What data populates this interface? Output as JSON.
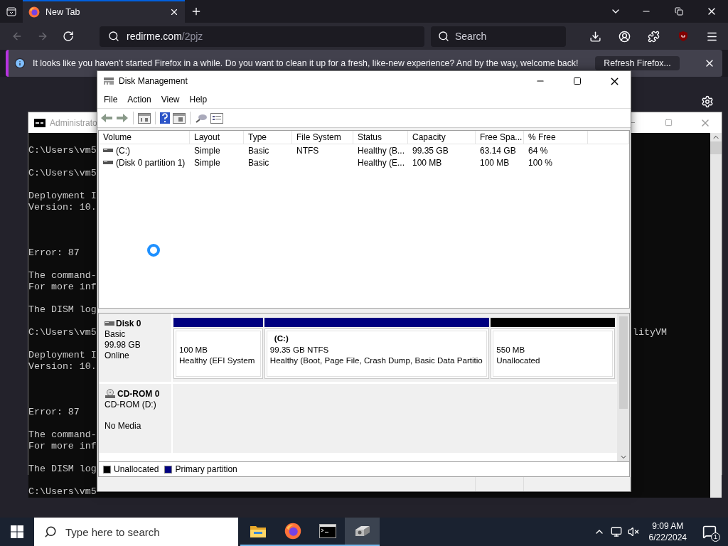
{
  "browser": {
    "tabs": [
      {
        "label": "New Tab",
        "selected": true
      }
    ],
    "nav": {
      "back_disabled": true,
      "forward_disabled": true
    },
    "url": {
      "domain": "redirme.com",
      "path": "/2pjz"
    },
    "search": {
      "placeholder": "Search"
    },
    "notification": {
      "message": "It looks like you haven’t started Firefox in a while. Do you want to clean it up for a fresh, like-new experience? And by the way, welcome back!",
      "button": "Refresh Firefox..."
    }
  },
  "console": {
    "title": "Administrato",
    "blocks": [
      {
        "lines": [
          {
            "text": "C:\\Users\\vm5"
          }
        ]
      },
      {
        "lines": [
          {
            "text": "C:\\Users\\vm5"
          }
        ]
      },
      {
        "lines": [
          {
            "text": "Deployment I"
          },
          {
            "text": "Version: 10."
          }
        ]
      },
      {
        "extra_blank_line": true,
        "lines": [
          {
            "text": "Error: 87"
          }
        ]
      },
      {
        "lines": [
          {
            "text": "The command-"
          },
          {
            "text": "For more inf"
          }
        ]
      },
      {
        "lines": [
          {
            "text": "The DISM log"
          }
        ]
      },
      {
        "lines": [
          {
            "text": "C:\\Users\\vm5",
            "right": "lityVM"
          }
        ]
      },
      {
        "lines": [
          {
            "text": "Deployment I"
          },
          {
            "text": "Version: 10."
          }
        ]
      },
      {
        "extra_blank_line": true,
        "lines": [
          {
            "text": "Error: 87"
          }
        ]
      },
      {
        "lines": [
          {
            "text": "The command-"
          },
          {
            "text": "For more inf"
          }
        ]
      },
      {
        "lines": [
          {
            "text": "The DISM log"
          }
        ]
      },
      {
        "lines": [
          {
            "text": "C:\\Users\\vm5"
          }
        ]
      }
    ]
  },
  "disk_management": {
    "title": "Disk Management",
    "menu": [
      "File",
      "Action",
      "View",
      "Help"
    ],
    "volume_table": {
      "columns": [
        "Volume",
        "Layout",
        "Type",
        "File System",
        "Status",
        "Capacity",
        "Free Spa...",
        "% Free"
      ],
      "rows": [
        {
          "volume": "(C:)",
          "layout": "Simple",
          "type": "Basic",
          "file_system": "NTFS",
          "status": "Healthy (B...",
          "capacity": "99.35 GB",
          "free_space": "63.14 GB",
          "percent_free": "64 %"
        },
        {
          "volume": "(Disk 0 partition 1)",
          "layout": "Simple",
          "type": "Basic",
          "status": "Healthy (E...",
          "capacity": "100 MB",
          "free_space": "100 MB",
          "percent_free": "100 %"
        }
      ]
    },
    "disks": [
      {
        "kind": "disk",
        "name": "Disk 0",
        "type": "Basic",
        "capacity": "99.98 GB",
        "status": "Online",
        "partitions": [
          {
            "color": "#000080",
            "size": "100 MB",
            "status": "Healthy (EFI System"
          },
          {
            "color": "#000080",
            "name": "(C:)",
            "size": "99.35 GB NTFS",
            "status": "Healthy (Boot, Page File, Crash Dump, Basic Data Partitio"
          },
          {
            "color": "#000000",
            "size": "550 MB",
            "status": "Unallocated"
          }
        ]
      },
      {
        "kind": "cdrom",
        "name": "CD-ROM 0",
        "type": "CD-ROM (D:)",
        "status": "No Media"
      }
    ],
    "legend": [
      {
        "label": "Unallocated",
        "color": "#000000"
      },
      {
        "label": "Primary partition",
        "color": "#000080"
      }
    ]
  },
  "taskbar": {
    "search": {
      "placeholder": "Type here to search"
    },
    "apps": [
      {
        "kind": "folder",
        "selected": false
      },
      {
        "kind": "browser",
        "selected": false
      },
      {
        "kind": "console",
        "selected": false
      },
      {
        "kind": "disk",
        "selected": true
      }
    ],
    "clock": {
      "time": "9:09 AM",
      "date": "6/22/2024"
    },
    "notifications": "1"
  }
}
